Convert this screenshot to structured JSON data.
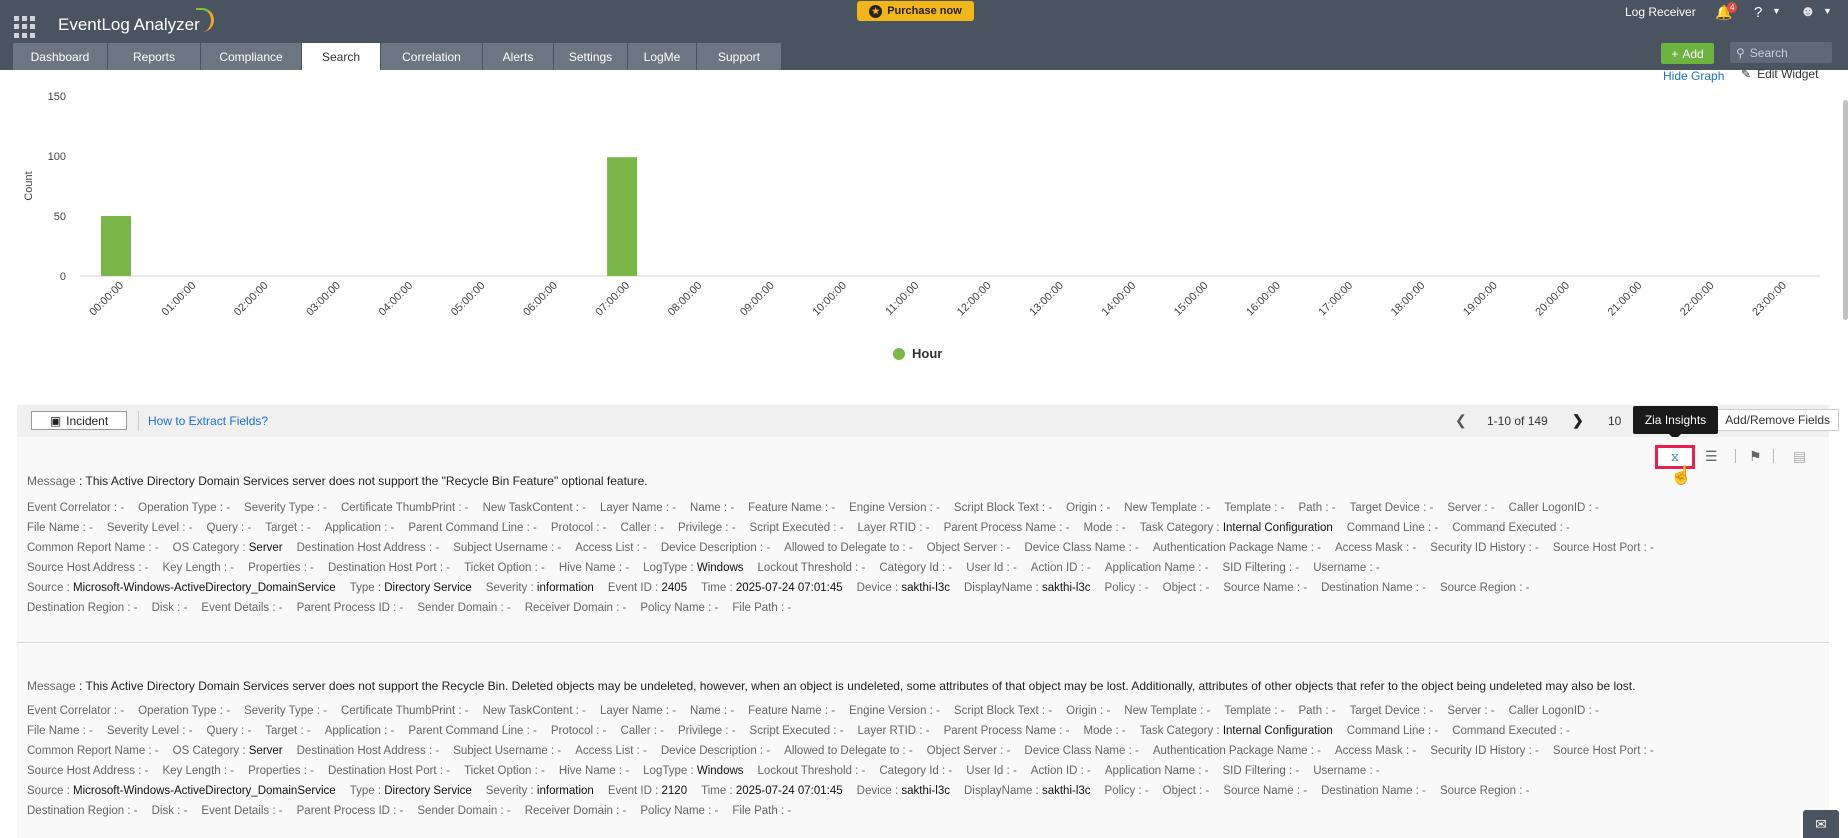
{
  "app": {
    "title": "EventLog Analyzer",
    "purchase_label": "Purchase now",
    "receiver_label": "Log Receiver",
    "notif_count": "4",
    "help_label": "?"
  },
  "nav": {
    "tabs": [
      {
        "label": "Dashboard",
        "active": false
      },
      {
        "label": "Reports",
        "active": false
      },
      {
        "label": "Compliance",
        "active": false
      },
      {
        "label": "Search",
        "active": true
      },
      {
        "label": "Correlation",
        "active": false
      },
      {
        "label": "Alerts",
        "active": false
      },
      {
        "label": "Settings",
        "active": false
      },
      {
        "label": "LogMe",
        "active": false
      },
      {
        "label": "Support",
        "active": false
      }
    ]
  },
  "actions": {
    "add_label": "Add",
    "search_placeholder": "Search"
  },
  "widget": {
    "hide_graph": "Hide Graph",
    "edit_widget": "Edit Widget"
  },
  "chart_data": {
    "type": "bar",
    "ylabel": "Count",
    "ylim": [
      0,
      150
    ],
    "yticks": [
      0,
      50,
      100,
      150
    ],
    "categories": [
      "00:00:00",
      "01:00:00",
      "02:00:00",
      "03:00:00",
      "04:00:00",
      "05:00:00",
      "06:00:00",
      "07:00:00",
      "08:00:00",
      "09:00:00",
      "10:00:00",
      "11:00:00",
      "12:00:00",
      "13:00:00",
      "14:00:00",
      "15:00:00",
      "16:00:00",
      "17:00:00",
      "18:00:00",
      "19:00:00",
      "20:00:00",
      "21:00:00",
      "22:00:00",
      "23:00:00"
    ],
    "series": [
      {
        "name": "Hour",
        "values": [
          50,
          0,
          0,
          0,
          0,
          0,
          0,
          99,
          0,
          0,
          0,
          0,
          0,
          0,
          0,
          0,
          0,
          0,
          0,
          0,
          0,
          0,
          0,
          0
        ]
      }
    ],
    "colors": {
      "bar": "#7ab648"
    },
    "grid": false,
    "legend": "bottom-center"
  },
  "toolbar": {
    "incident_label": "Incident",
    "extract_link": "How to Extract Fields?",
    "page_range": "1-10 of 149",
    "per_page": "10",
    "add_remove": "Add/Remove Fields",
    "tooltip": "Zia Insights"
  },
  "records": [
    {
      "message_label": "Message",
      "message": "This Active Directory Domain Services server does not support the \"Recycle Bin Feature\" optional feature.",
      "rows": [
        [
          [
            "Event Correlator",
            "-"
          ],
          [
            "Operation Type",
            "-"
          ],
          [
            "Severity Type",
            "-"
          ],
          [
            "Certificate ThumbPrint",
            "-"
          ],
          [
            "New TaskContent",
            "-"
          ],
          [
            "Layer Name",
            "-"
          ],
          [
            "Name",
            "-"
          ],
          [
            "Feature Name",
            "-"
          ],
          [
            "Engine Version",
            "-"
          ],
          [
            "Script Block Text",
            "-"
          ],
          [
            "Origin",
            "-"
          ],
          [
            "New Template",
            "-"
          ],
          [
            "Template",
            "-"
          ],
          [
            "Path",
            "-"
          ],
          [
            "Target Device",
            "-"
          ],
          [
            "Server",
            "-"
          ],
          [
            "Caller LogonID",
            "-"
          ]
        ],
        [
          [
            "File Name",
            "-"
          ],
          [
            "Severity Level",
            "-"
          ],
          [
            "Query",
            "-"
          ],
          [
            "Target",
            "-"
          ],
          [
            "Application",
            "-"
          ],
          [
            "Parent Command Line",
            "-"
          ],
          [
            "Protocol",
            "-"
          ],
          [
            "Caller",
            "-"
          ],
          [
            "Privilege",
            "-"
          ],
          [
            "Script Executed",
            "-"
          ],
          [
            "Layer RTID",
            "-"
          ],
          [
            "Parent Process Name",
            "-"
          ],
          [
            "Mode",
            "-"
          ],
          [
            "Task Category",
            "Internal Configuration"
          ],
          [
            "Command Line",
            "-"
          ],
          [
            "Command Executed",
            "-"
          ]
        ],
        [
          [
            "Common Report Name",
            "-"
          ],
          [
            "OS Category",
            "Server"
          ],
          [
            "Destination Host Address",
            "-"
          ],
          [
            "Subject Username",
            "-"
          ],
          [
            "Access List",
            "-"
          ],
          [
            "Device Description",
            "-"
          ],
          [
            "Allowed to Delegate to",
            "-"
          ],
          [
            "Object Server",
            "-"
          ],
          [
            "Device Class Name",
            "-"
          ],
          [
            "Authentication Package Name",
            "-"
          ],
          [
            "Access Mask",
            "-"
          ],
          [
            "Security ID History",
            "-"
          ],
          [
            "Source Host Port",
            "-"
          ]
        ],
        [
          [
            "Source Host Address",
            "-"
          ],
          [
            "Key Length",
            "-"
          ],
          [
            "Properties",
            "-"
          ],
          [
            "Destination Host Port",
            "-"
          ],
          [
            "Ticket Option",
            "-"
          ],
          [
            "Hive Name",
            "-"
          ],
          [
            "LogType",
            "Windows"
          ],
          [
            "Lockout Threshold",
            "-"
          ],
          [
            "Category Id",
            "-"
          ],
          [
            "User Id",
            "-"
          ],
          [
            "Action ID",
            "-"
          ],
          [
            "Application Name",
            "-"
          ],
          [
            "SID Filtering",
            "-"
          ],
          [
            "Username",
            "-"
          ]
        ],
        [
          [
            "Source",
            "Microsoft-Windows-ActiveDirectory_DomainService"
          ],
          [
            "Type",
            "Directory Service"
          ],
          [
            "Severity",
            "information"
          ],
          [
            "Event ID",
            "2405"
          ],
          [
            "Time",
            "2025-07-24 07:01:45"
          ],
          [
            "Device",
            "sakthi-l3c"
          ],
          [
            "DisplayName",
            "sakthi-l3c"
          ],
          [
            "Policy",
            "-"
          ],
          [
            "Object",
            "-"
          ],
          [
            "Source Name",
            "-"
          ],
          [
            "Destination Name",
            "-"
          ],
          [
            "Source Region",
            "-"
          ]
        ],
        [
          [
            "Destination Region",
            "-"
          ],
          [
            "Disk",
            "-"
          ],
          [
            "Event Details",
            "-"
          ],
          [
            "Parent Process ID",
            "-"
          ],
          [
            "Sender Domain",
            "-"
          ],
          [
            "Receiver Domain",
            "-"
          ],
          [
            "Policy Name",
            "-"
          ],
          [
            "File Path",
            "-"
          ]
        ]
      ]
    },
    {
      "message_label": "Message",
      "message": "This Active Directory Domain Services server does not support the Recycle Bin. Deleted objects may be undeleted, however, when an object is undeleted, some attributes of that object may be lost. Additionally, attributes of other objects that refer to the object being undeleted may also be lost.",
      "rows": [
        [
          [
            "Event Correlator",
            "-"
          ],
          [
            "Operation Type",
            "-"
          ],
          [
            "Severity Type",
            "-"
          ],
          [
            "Certificate ThumbPrint",
            "-"
          ],
          [
            "New TaskContent",
            "-"
          ],
          [
            "Layer Name",
            "-"
          ],
          [
            "Name",
            "-"
          ],
          [
            "Feature Name",
            "-"
          ],
          [
            "Engine Version",
            "-"
          ],
          [
            "Script Block Text",
            "-"
          ],
          [
            "Origin",
            "-"
          ],
          [
            "New Template",
            "-"
          ],
          [
            "Template",
            "-"
          ],
          [
            "Path",
            "-"
          ],
          [
            "Target Device",
            "-"
          ],
          [
            "Server",
            "-"
          ],
          [
            "Caller LogonID",
            "-"
          ]
        ],
        [
          [
            "File Name",
            "-"
          ],
          [
            "Severity Level",
            "-"
          ],
          [
            "Query",
            "-"
          ],
          [
            "Target",
            "-"
          ],
          [
            "Application",
            "-"
          ],
          [
            "Parent Command Line",
            "-"
          ],
          [
            "Protocol",
            "-"
          ],
          [
            "Caller",
            "-"
          ],
          [
            "Privilege",
            "-"
          ],
          [
            "Script Executed",
            "-"
          ],
          [
            "Layer RTID",
            "-"
          ],
          [
            "Parent Process Name",
            "-"
          ],
          [
            "Mode",
            "-"
          ],
          [
            "Task Category",
            "Internal Configuration"
          ],
          [
            "Command Line",
            "-"
          ],
          [
            "Command Executed",
            "-"
          ]
        ],
        [
          [
            "Common Report Name",
            "-"
          ],
          [
            "OS Category",
            "Server"
          ],
          [
            "Destination Host Address",
            "-"
          ],
          [
            "Subject Username",
            "-"
          ],
          [
            "Access List",
            "-"
          ],
          [
            "Device Description",
            "-"
          ],
          [
            "Allowed to Delegate to",
            "-"
          ],
          [
            "Object Server",
            "-"
          ],
          [
            "Device Class Name",
            "-"
          ],
          [
            "Authentication Package Name",
            "-"
          ],
          [
            "Access Mask",
            "-"
          ],
          [
            "Security ID History",
            "-"
          ],
          [
            "Source Host Port",
            "-"
          ]
        ],
        [
          [
            "Source Host Address",
            "-"
          ],
          [
            "Key Length",
            "-"
          ],
          [
            "Properties",
            "-"
          ],
          [
            "Destination Host Port",
            "-"
          ],
          [
            "Ticket Option",
            "-"
          ],
          [
            "Hive Name",
            "-"
          ],
          [
            "LogType",
            "Windows"
          ],
          [
            "Lockout Threshold",
            "-"
          ],
          [
            "Category Id",
            "-"
          ],
          [
            "User Id",
            "-"
          ],
          [
            "Action ID",
            "-"
          ],
          [
            "Application Name",
            "-"
          ],
          [
            "SID Filtering",
            "-"
          ],
          [
            "Username",
            "-"
          ]
        ],
        [
          [
            "Source",
            "Microsoft-Windows-ActiveDirectory_DomainService"
          ],
          [
            "Type",
            "Directory Service"
          ],
          [
            "Severity",
            "information"
          ],
          [
            "Event ID",
            "2120"
          ],
          [
            "Time",
            "2025-07-24 07:01:45"
          ],
          [
            "Device",
            "sakthi-l3c"
          ],
          [
            "DisplayName",
            "sakthi-l3c"
          ],
          [
            "Policy",
            "-"
          ],
          [
            "Object",
            "-"
          ],
          [
            "Source Name",
            "-"
          ],
          [
            "Destination Name",
            "-"
          ],
          [
            "Source Region",
            "-"
          ]
        ],
        [
          [
            "Destination Region",
            "-"
          ],
          [
            "Disk",
            "-"
          ],
          [
            "Event Details",
            "-"
          ],
          [
            "Parent Process ID",
            "-"
          ],
          [
            "Sender Domain",
            "-"
          ],
          [
            "Receiver Domain",
            "-"
          ],
          [
            "Policy Name",
            "-"
          ],
          [
            "File Path",
            "-"
          ]
        ]
      ]
    }
  ],
  "icons": {
    "apps": "apps-grid-icon",
    "bell": "bell-icon",
    "user": "user-icon",
    "zia": "zia-insights-icon",
    "edit": "edit-fields-icon",
    "tag": "tag-icon",
    "view": "view-log-icon",
    "chat": "chat-icon"
  }
}
